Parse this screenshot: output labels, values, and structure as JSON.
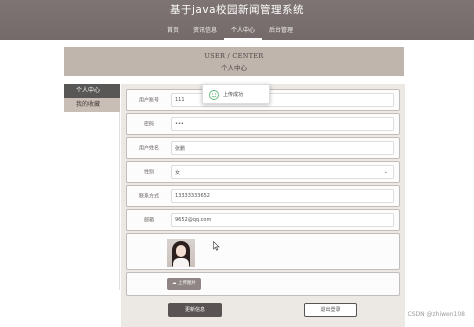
{
  "header": {
    "site_title": "基于java校园新闻管理系统",
    "nav": [
      "首页",
      "资讯信息",
      "个人中心",
      "后台管理"
    ],
    "active_nav": "个人中心"
  },
  "banner": {
    "title_en": "USER / CENTER",
    "title_cn": "个人中心"
  },
  "sidebar": {
    "items": [
      "个人中心",
      "我的收藏"
    ],
    "active_item": "个人中心"
  },
  "form": {
    "account": {
      "label": "用户账号",
      "value": "111"
    },
    "password": {
      "label": "密码",
      "value": "•••"
    },
    "name": {
      "label": "用户姓名",
      "value": "张鹏"
    },
    "gender": {
      "label": "性别",
      "value": "女"
    },
    "phone": {
      "label": "联系方式",
      "value": "13333333652"
    },
    "email": {
      "label": "邮箱",
      "value": "9652@qq.com"
    }
  },
  "upload_button_label": "上传图片",
  "buttons": {
    "save": "更新信息",
    "logout": "退出登录"
  },
  "toast": {
    "text": "上传成功"
  },
  "colors": {
    "header": "#7b7070",
    "banner": "#bfb5ad",
    "sidebar_active": "#595656",
    "sidebar_normal": "#c9beb5",
    "toast_success": "#5fb878"
  },
  "watermark": "CSDN @zhiwen108"
}
